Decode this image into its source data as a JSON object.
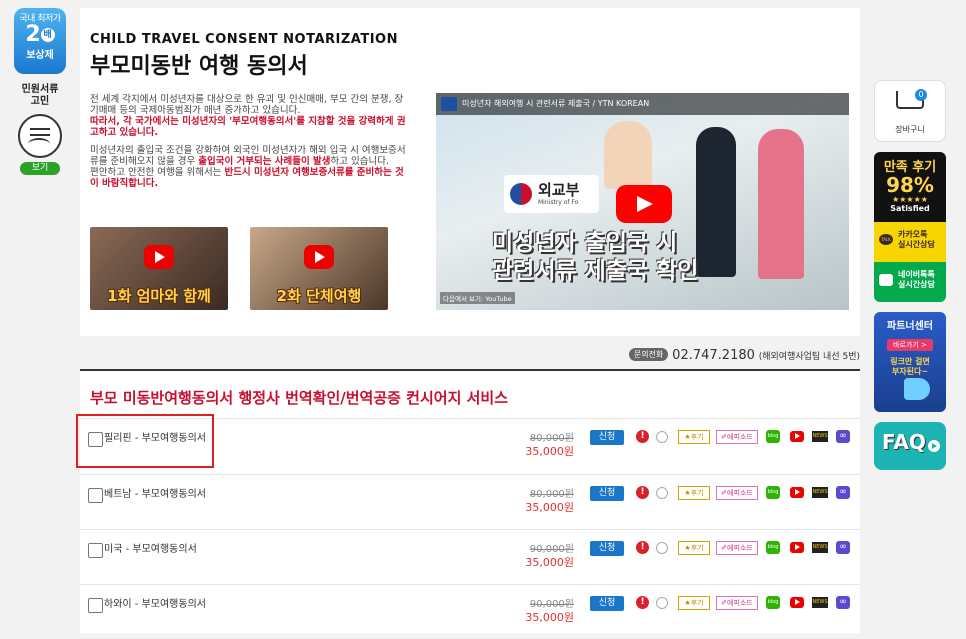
{
  "left_rail": {
    "promo_top": "국내 최저가",
    "promo_num": "2",
    "promo_unit": "배",
    "promo_bottom": "보상제",
    "doc_line1": "민원서류",
    "doc_line2": "고민",
    "view_btn": "보기"
  },
  "header": {
    "eng_title": "CHILD TRAVEL CONSENT NOTARIZATION",
    "kor_title": "부모미동반 여행 동의서"
  },
  "desc": {
    "p1_line1": "전 세계 각지에서 미성년자를 대상으로 한 유괴 및 인신매매, 부모 간의 분쟁, 장기매매 등의 국제아동범죄가 매년 증가하고 있습니다.",
    "p1_red": "따라서, 각 국가에서는 미성년자의 '부모여행동의서'를 지참할 것을 강력하게 권고하고 있습니다.",
    "p2_line1": "미성년자의 출입국 조건을 강화하여 외국인 미성년자가 해외 입국 시 여행보증서류를 준비해오지 않을 경우 ",
    "p2_red1": "출입국이 거부되는 사례들이 발생",
    "p2_line2": "하고 있습니다.",
    "p2_line3": "편안하고 안전한 여행을 위해서는 ",
    "p2_red2": "반드시 미성년자 여행보증서류를 준비하는 것이 바람직합니다."
  },
  "thumbs": [
    {
      "caption": "1화 엄마와 함께"
    },
    {
      "caption": "2화 단체여행"
    }
  ],
  "video": {
    "top_text": "미성년자 해외여행 시 관련서류 제출국 / YTN KOREAN",
    "brand": "외교부",
    "brand_sub": "Ministry of Fo",
    "caption_line1": "미성년자 출입국 시",
    "caption_line2": "관련서류 제출국 확인",
    "bottom_text": "다음에서 보기: YouTube"
  },
  "contact": {
    "tag": "문의전화",
    "phone": "02.747.2180",
    "note": "(해외여행사업팀 내선 5번)"
  },
  "service": {
    "title": "부모 미동반여행동의서 행정사 번역확인/번역공증 컨시어지 서비스",
    "labels": {
      "apply": "신청",
      "review": "★후기",
      "episode": "✐에피소드",
      "blog": "blog",
      "news": "NEWS",
      "warn": "!",
      "link": "∞"
    },
    "rows": [
      {
        "name": "필리핀 - 부모여행동의서",
        "old_price": "80,000원",
        "new_price": "35,000원"
      },
      {
        "name": "베트남 - 부모여행동의서",
        "old_price": "80,000원",
        "new_price": "35,000원"
      },
      {
        "name": "미국 - 부모여행동의서",
        "old_price": "90,000원",
        "new_price": "35,000원"
      },
      {
        "name": "하와이 - 부모여행동의서",
        "old_price": "90,000원",
        "new_price": "35,000원"
      }
    ]
  },
  "right_rail": {
    "cart_count": "0",
    "cart_label": "장바구니",
    "sat_title": "만족 후기",
    "sat_pct": "98%",
    "sat_stars": "★★★★★",
    "sat_label": "Satisfied",
    "kakao_line1": "카카오톡",
    "kakao_line2": "실시간상담",
    "kakao_icon": "TALK",
    "naver_line1": "네이버톡톡",
    "naver_line2": "실시간상담",
    "partner_title": "파트너센터",
    "partner_btn": "바로가기 >",
    "partner_line1": "링크만 걸면",
    "partner_line2": "부자된다~",
    "faq": "FAQ"
  }
}
